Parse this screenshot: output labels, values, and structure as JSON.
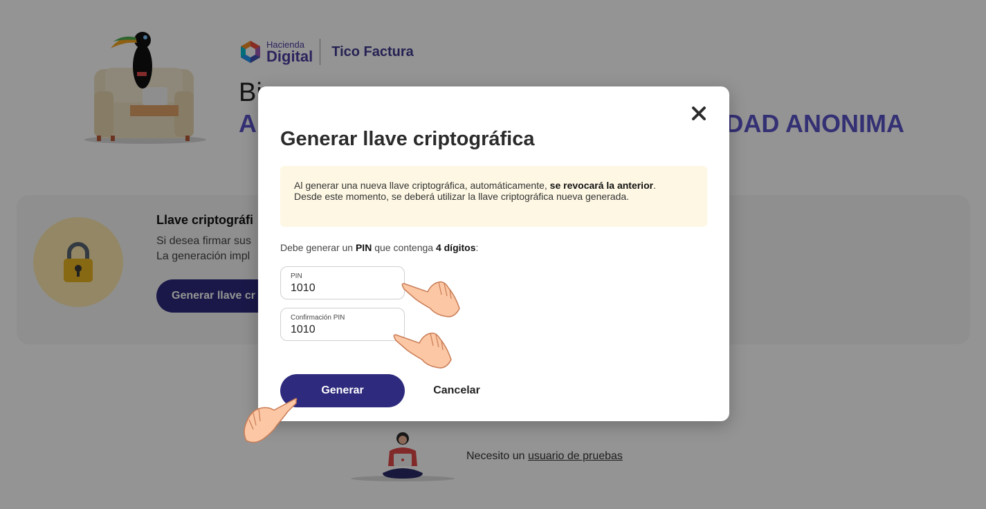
{
  "brand": {
    "small": "Hacienda",
    "big": "Digital",
    "product": "Tico Factura"
  },
  "header": {
    "welcome_partial": "Bi",
    "company_left": "A",
    "company_right": "DAD ANONIMA"
  },
  "card": {
    "title_partial": "Llave criptográfi",
    "line1_partial": "Si desea firmar sus",
    "line2_partial": "La generación impl",
    "trailing": ".",
    "button_partial": "Generar llave cr"
  },
  "footer": {
    "prefix": "Necesito un ",
    "link": "usuario de pruebas"
  },
  "modal": {
    "title": "Generar llave criptográfica",
    "alert": {
      "text1": "Al generar una nueva llave criptográfica, automáticamente, ",
      "bold1": "se revocará la anterior",
      "text2": ".",
      "line2": "Desde este momento, se deberá utilizar la llave criptográfica nueva generada."
    },
    "pin_requirement": {
      "text1": "Debe generar un ",
      "bold1": "PIN",
      "text2": " que contenga ",
      "bold2": "4 dígitos",
      "text3": ":"
    },
    "pin_field": {
      "label": "PIN",
      "value": "1010"
    },
    "confirm_field": {
      "label": "Confirmación PIN",
      "value": "1010"
    },
    "generate_label": "Generar",
    "cancel_label": "Cancelar"
  },
  "colors": {
    "primary": "#2e2a7d",
    "accent_purple": "#5b53c8",
    "alert_bg": "#fdf7e3",
    "lock_yellow": "#e9b322"
  },
  "icons": [
    "toucan-illustration",
    "hacienda-logo",
    "lock-icon",
    "close-icon",
    "pointing-hand-icon",
    "girl-laptop-illustration"
  ]
}
